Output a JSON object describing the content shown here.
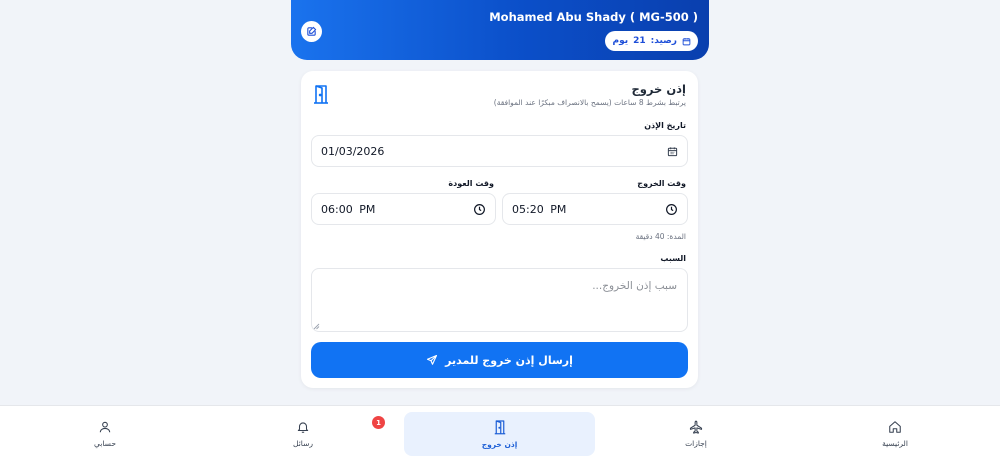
{
  "header": {
    "title": "Mohamed Abu Shady ( MG-500 )",
    "balance_label": "رصيد:",
    "balance_value": "21",
    "balance_unit": "يوم",
    "icons": [
      "edit-icon",
      "calendar-icon"
    ]
  },
  "form": {
    "title": "إذن خروج",
    "subtitle": "يرتبط بشرط 8 ساعات (يسمح بالانصراف مبكرًا عند الموافقة)",
    "date_label": "تاريخ الإذن",
    "date_value": "01/03/2026",
    "exit_time_label": "وقت الخروج",
    "exit_time_value": "05:20 PM",
    "return_time_label": "وقت العودة",
    "return_time_value": "06:00 PM",
    "duration_text": "المدة: 40 دقيقة",
    "reason_label": "السبب",
    "reason_placeholder": "سبب إذن الخروج...",
    "submit_label": "إرسال إذن خروج للمدير"
  },
  "nav": {
    "items": [
      {
        "label": "الرئيسية",
        "icon": "home-icon"
      },
      {
        "label": "إجازات",
        "icon": "plane-icon"
      },
      {
        "label": "إذن خروج",
        "icon": "door-icon"
      },
      {
        "label": "رسائل",
        "icon": "bell-icon"
      },
      {
        "label": "حسابي",
        "icon": "user-icon"
      }
    ],
    "messages_badge": "1"
  },
  "colors": {
    "primary": "#1173f3",
    "header_gradient_start": "#1a73ee",
    "header_gradient_end": "#0a3fae",
    "badge": "#ef4444"
  }
}
